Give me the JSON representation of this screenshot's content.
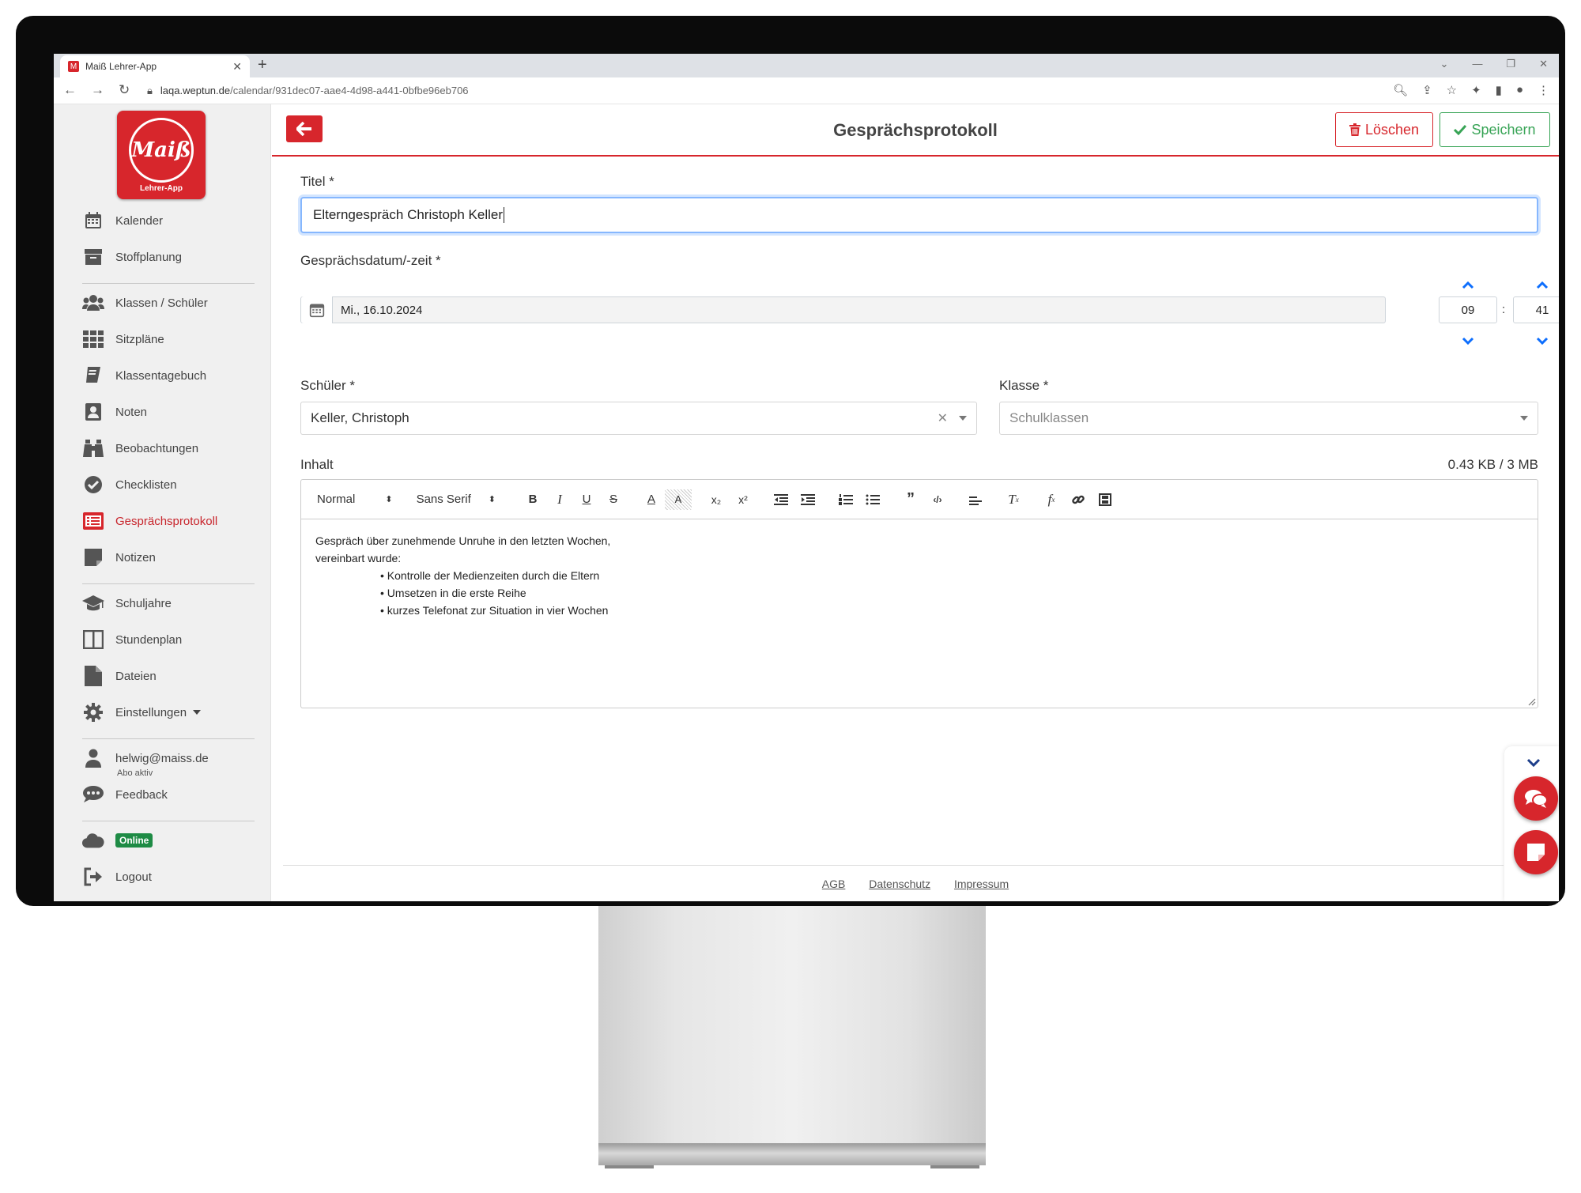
{
  "browser": {
    "tab_title": "Maiß Lehrer-App",
    "url_host": "laqa.weptun.de",
    "url_path": "/calendar/931dec07-aae4-4d98-a441-0bfbe96eb706"
  },
  "logo": {
    "text": "Maiß",
    "subtitle": "Lehrer-App"
  },
  "sidebar": {
    "items": [
      {
        "label": "Kalender",
        "icon": "calendar-icon"
      },
      {
        "label": "Stoffplanung",
        "icon": "archive-icon"
      },
      {
        "label": "Klassen / Schüler",
        "icon": "users-icon"
      },
      {
        "label": "Sitzpläne",
        "icon": "grid-icon"
      },
      {
        "label": "Klassentagebuch",
        "icon": "book-icon"
      },
      {
        "label": "Noten",
        "icon": "grade-icon"
      },
      {
        "label": "Beobachtungen",
        "icon": "binoculars-icon"
      },
      {
        "label": "Checklisten",
        "icon": "check-circle-icon"
      },
      {
        "label": "Gesprächsprotokoll",
        "icon": "list-icon"
      },
      {
        "label": "Notizen",
        "icon": "note-icon"
      },
      {
        "label": "Schuljahre",
        "icon": "graduation-cap-icon"
      },
      {
        "label": "Stundenplan",
        "icon": "columns-icon"
      },
      {
        "label": "Dateien",
        "icon": "file-icon"
      },
      {
        "label": "Einstellungen",
        "icon": "gear-icon"
      }
    ],
    "user_email": "helwig@maiss.de",
    "abo_status": "Abo aktiv",
    "feedback": "Feedback",
    "online": "Online",
    "logout": "Logout"
  },
  "header": {
    "title": "Gesprächsprotokoll",
    "delete_label": "Löschen",
    "save_label": "Speichern"
  },
  "form": {
    "title_label": "Titel *",
    "title_value": "Elterngespräch Christoph Keller",
    "date_label": "Gesprächsdatum/-zeit *",
    "date_value": "Mi., 16.10.2024",
    "hour": "09",
    "time_sep": ":",
    "minute": "41",
    "student_label": "Schüler *",
    "student_value": "Keller, Christoph",
    "class_label": "Klasse *",
    "class_placeholder": "Schulklassen",
    "content_label": "Inhalt",
    "size_info": "0.43 KB / 3 MB"
  },
  "toolbar": {
    "format": "Normal",
    "font": "Sans Serif"
  },
  "editor": {
    "line1": "Gespräch über zunehmende Unruhe in den letzten Wochen,",
    "line2": "vereinbart wurde:",
    "bullets": [
      "• Kontrolle der Medienzeiten durch die Eltern",
      "• Umsetzen in die erste Reihe",
      "• kurzes Telefonat zur Situation in vier Wochen"
    ]
  },
  "footer": {
    "agb": "AGB",
    "datenschutz": "Datenschutz",
    "impressum": "Impressum"
  },
  "colors": {
    "brand_red": "#d7262c",
    "save_green": "#38a456",
    "focus_blue": "#86b7fe",
    "online_green": "#1e8b45",
    "time_arrow_blue": "#0d6efd"
  }
}
